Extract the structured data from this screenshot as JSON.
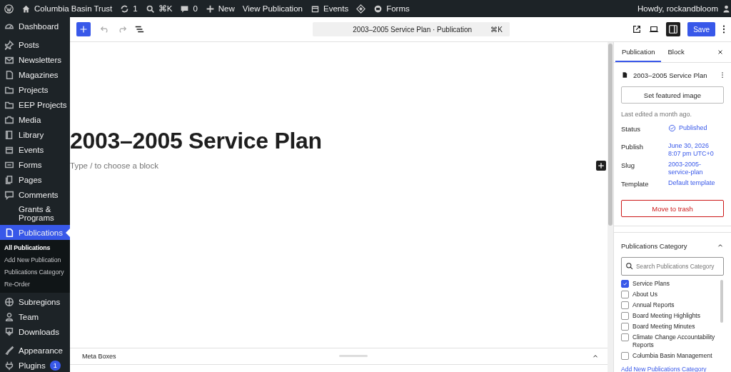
{
  "admin_bar": {
    "site": "Columbia Basin Trust",
    "updates": "1",
    "search_shortcut": "⌘K",
    "comments": "0",
    "new": "New",
    "view": "View Publication",
    "events": "Events",
    "forms": "Forms",
    "greeting": "Howdy, rockandbloom"
  },
  "sidebar": {
    "groups": [
      {
        "items": [
          {
            "label": "Dashboard",
            "selected": false
          }
        ]
      },
      {
        "items": [
          {
            "label": "Posts",
            "selected": false
          },
          {
            "label": "Newsletters",
            "selected": false
          },
          {
            "label": "Magazines",
            "selected": false
          },
          {
            "label": "Projects",
            "selected": false
          },
          {
            "label": "EEP Projects",
            "selected": false
          },
          {
            "label": "Media",
            "selected": false
          },
          {
            "label": "Library",
            "selected": false
          },
          {
            "label": "Events",
            "selected": false
          },
          {
            "label": "Forms",
            "selected": false
          },
          {
            "label": "Pages",
            "selected": false
          },
          {
            "label": "Comments",
            "selected": false
          },
          {
            "label": "Grants & Programs",
            "selected": false
          },
          {
            "label": "Publications",
            "selected": true,
            "children": [
              {
                "label": "All Publications",
                "selected": true
              },
              {
                "label": "Add New Publication",
                "selected": false
              },
              {
                "label": "Publications Category",
                "selected": false
              },
              {
                "label": "Re-Order",
                "selected": false
              }
            ]
          },
          {
            "label": "Subregions",
            "selected": false
          },
          {
            "label": "Team",
            "selected": false
          },
          {
            "label": "Downloads",
            "selected": false
          }
        ]
      },
      {
        "items": [
          {
            "label": "Appearance",
            "selected": false
          },
          {
            "label": "Plugins",
            "selected": false,
            "badge": "1"
          }
        ]
      }
    ]
  },
  "toolbar": {
    "document_title": "2003–2005 Service Plan · Publication",
    "shortcut": "⌘K",
    "sidebar_open": true,
    "save": "Save"
  },
  "editor": {
    "title": "2003–2005 Service Plan",
    "placeholder": "Type / to choose a block"
  },
  "meta_boxes": {
    "label": "Meta Boxes",
    "expanded": false
  },
  "settings": {
    "tabs": [
      {
        "label": "Publication",
        "selected": true
      },
      {
        "label": "Block",
        "selected": false
      }
    ],
    "post_title": "2003–2005 Service Plan",
    "featured_image_button": "Set featured image",
    "last_edited": "Last edited a month ago.",
    "fields": [
      {
        "label": "Status",
        "value": "Published",
        "kind": "status"
      },
      {
        "label": "Publish",
        "value": "June 30, 2026 8:07 pm UTC+0",
        "kind": "link"
      },
      {
        "label": "Slug",
        "value": "2003-2005-service-plan",
        "kind": "link"
      },
      {
        "label": "Template",
        "value": "Default template",
        "kind": "link"
      }
    ],
    "trash_button": "Move to trash"
  },
  "categories": {
    "title": "Publications Category",
    "expanded": true,
    "search_placeholder": "Search Publications Category",
    "items": [
      {
        "label": "Service Plans",
        "checked": true
      },
      {
        "label": "About Us",
        "checked": false
      },
      {
        "label": "Annual Reports",
        "checked": false
      },
      {
        "label": "Board Meeting Highlights",
        "checked": false
      },
      {
        "label": "Board Meeting Minutes",
        "checked": false
      },
      {
        "label": "Climate Change Accountability Reports",
        "checked": false
      },
      {
        "label": "Columbia Basin Management",
        "checked": false
      }
    ],
    "add_link": "Add New Publications Category"
  }
}
